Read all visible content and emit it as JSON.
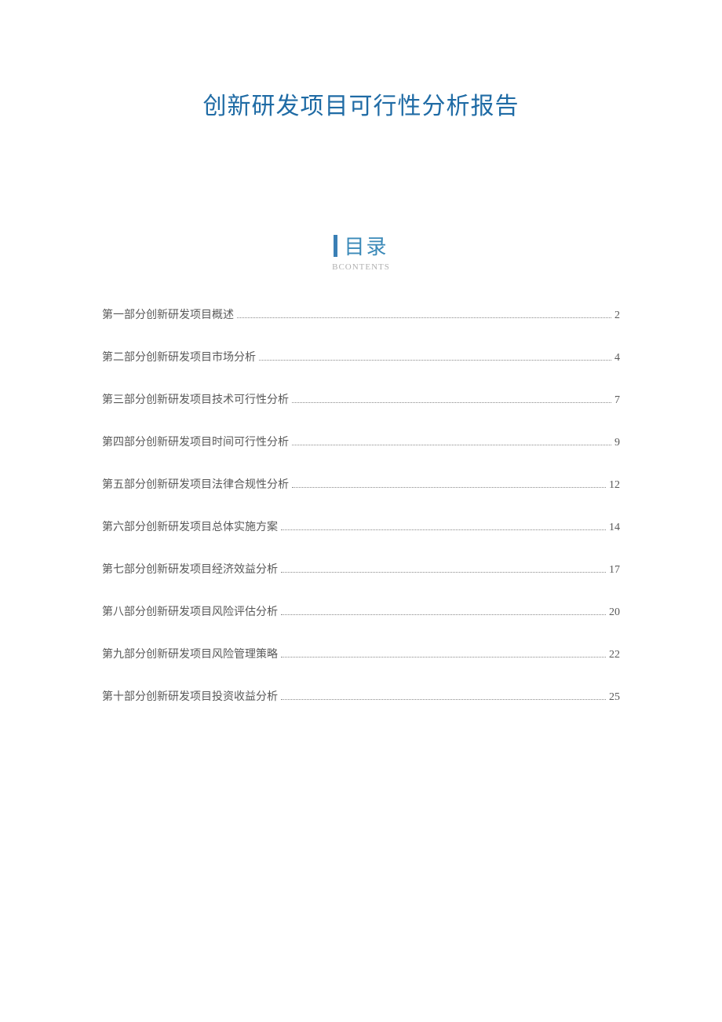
{
  "title": "创新研发项目可行性分析报告",
  "contents_header": {
    "cn": "目录",
    "en": "BCONTENTS"
  },
  "toc": [
    {
      "label": "第一部分创新研发项目概述",
      "page": "2"
    },
    {
      "label": "第二部分创新研发项目市场分析",
      "page": "4"
    },
    {
      "label": "第三部分创新研发项目技术可行性分析",
      "page": "7"
    },
    {
      "label": "第四部分创新研发项目时间可行性分析",
      "page": "9"
    },
    {
      "label": "第五部分创新研发项目法律合规性分析",
      "page": "12"
    },
    {
      "label": "第六部分创新研发项目总体实施方案",
      "page": "14"
    },
    {
      "label": "第七部分创新研发项目经济效益分析",
      "page": "17"
    },
    {
      "label": "第八部分创新研发项目风险评估分析",
      "page": "20"
    },
    {
      "label": "第九部分创新研发项目风险管理策略",
      "page": "22"
    },
    {
      "label": "第十部分创新研发项目投资收益分析",
      "page": "25"
    }
  ]
}
